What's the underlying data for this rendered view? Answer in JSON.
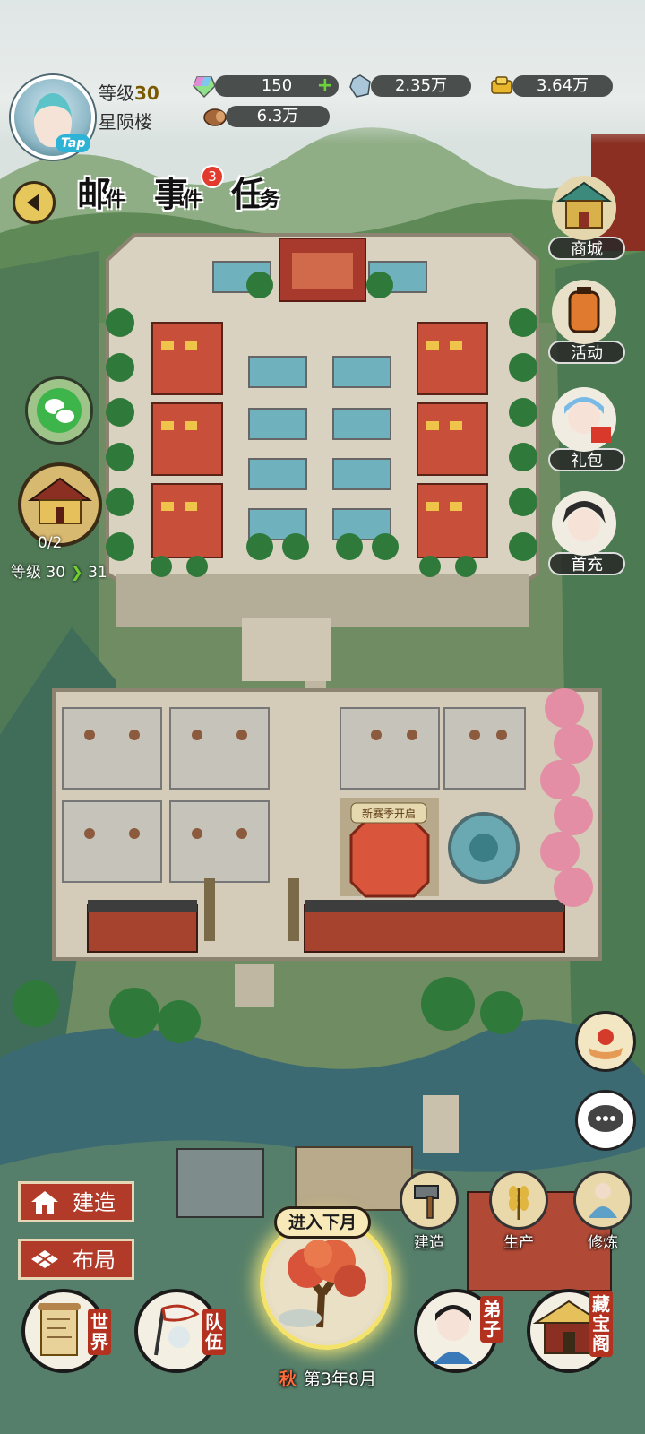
{
  "player": {
    "level_label": "等级",
    "level": "30",
    "sect_name": "星陨楼",
    "tap_label": "Tap"
  },
  "resources": {
    "jade": "150",
    "stone": "2.35万",
    "gold": "3.64万",
    "wood": "6.3万"
  },
  "tabs": [
    {
      "label": "邮件",
      "big": "邮",
      "small": "件"
    },
    {
      "label": "事件",
      "big": "事",
      "small": "件",
      "badge": "3"
    },
    {
      "label": "任务",
      "big": "任",
      "small": "务"
    }
  ],
  "side_menu": [
    "商城",
    "活动",
    "礼包",
    "首充"
  ],
  "palace": {
    "count": "0/2",
    "level_from": "等级 30",
    "level_to": "31"
  },
  "map_sign": "新赛季开启",
  "bottom_left": {
    "build": "建造",
    "layout": "布局"
  },
  "actions": [
    "建造",
    "生产",
    "修炼"
  ],
  "season": {
    "next_month": "进入下月",
    "season": "秋",
    "date": "第3年8月"
  },
  "bottom_nav": [
    {
      "name": "world",
      "chars": [
        "世",
        "界"
      ]
    },
    {
      "name": "team",
      "chars": [
        "队",
        "伍"
      ]
    },
    {
      "name": "disciples",
      "chars": [
        "弟",
        "子"
      ]
    },
    {
      "name": "treasure",
      "chars": [
        "藏",
        "宝",
        "阁"
      ]
    }
  ],
  "colors": {
    "accent_red": "#b23a28",
    "resource_bar": "#4a4f4d",
    "plus_green": "#6bd43c",
    "badge_red": "#e23a2c"
  }
}
